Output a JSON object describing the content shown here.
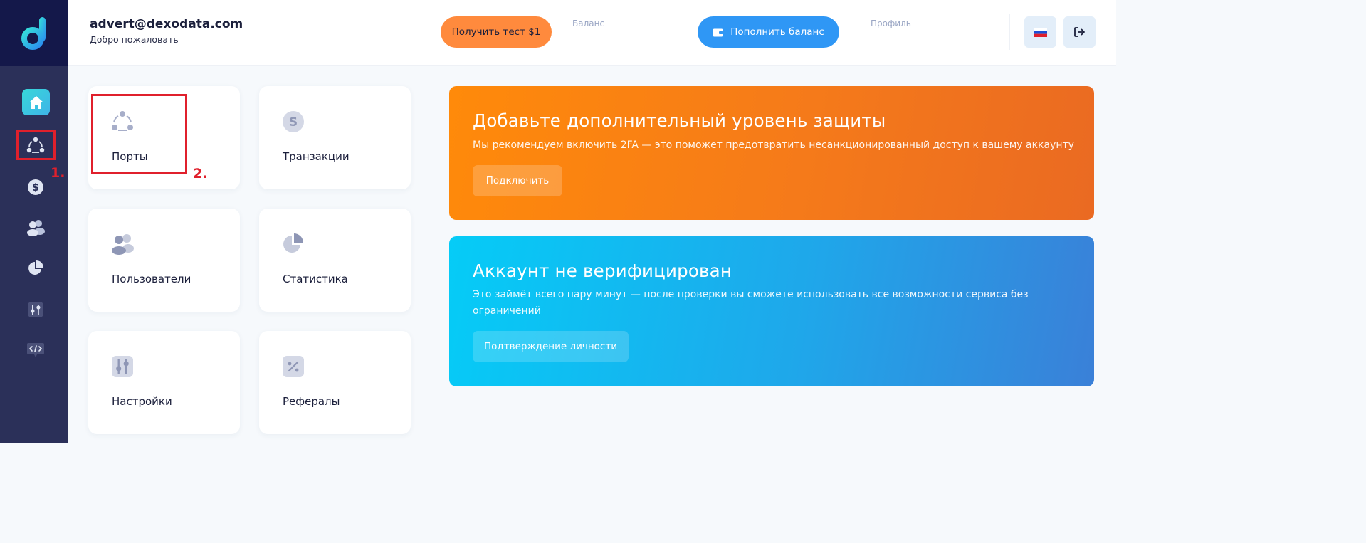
{
  "sidebar": {
    "items": [
      {
        "name": "home",
        "icon": "home-icon"
      },
      {
        "name": "ports",
        "icon": "ports-icon"
      },
      {
        "name": "transactions",
        "icon": "dollar-icon"
      },
      {
        "name": "users",
        "icon": "users-icon"
      },
      {
        "name": "statistics",
        "icon": "pie-chart-icon"
      },
      {
        "name": "settings",
        "icon": "sliders-icon"
      },
      {
        "name": "api",
        "icon": "code-chat-icon"
      }
    ]
  },
  "header": {
    "email": "advert@dexodata.com",
    "welcome": "Добро пожаловать",
    "test_button": "Получить тест $1",
    "balance_label": "Баланс",
    "topup_button": "Пополнить баланс",
    "profile_label": "Профиль"
  },
  "cards": [
    {
      "label": "Порты",
      "icon": "ports-icon"
    },
    {
      "label": "Транзакции",
      "icon": "coin-s-icon"
    },
    {
      "label": "Пользователи",
      "icon": "users-icon"
    },
    {
      "label": "Статистика",
      "icon": "pie-chart-icon"
    },
    {
      "label": "Настройки",
      "icon": "sliders-icon"
    },
    {
      "label": "Рефералы",
      "icon": "percent-icon"
    }
  ],
  "banners": {
    "twofa": {
      "title": "Добавьте дополнительный уровень защиты",
      "text": "Мы рекомендуем включить 2FA — это поможет предотвратить несанкционированный доступ к вашему аккаунту",
      "button": "Подключить"
    },
    "verify": {
      "title": "Аккаунт не верифицирован",
      "text": "Это займёт всего пару минут — после проверки вы сможете использовать все возможности сервиса без ограничений",
      "button": "Подтверждение личности"
    }
  },
  "annotations": [
    "1.",
    "2."
  ],
  "colors": {
    "sidebar": "#2b3059",
    "accent_orange": "#ff8a3d",
    "accent_blue": "#2f97f5",
    "annotation_red": "#e0202c"
  }
}
